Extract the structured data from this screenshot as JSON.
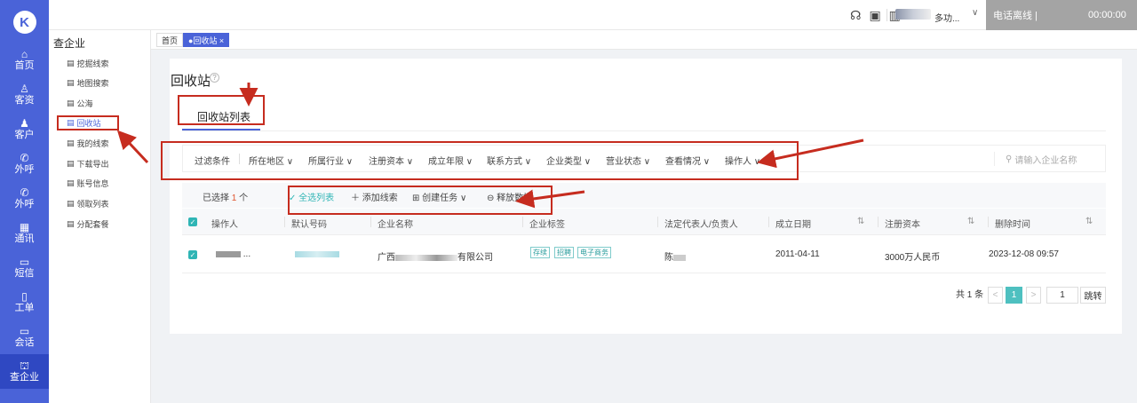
{
  "rail": {
    "logo": "K",
    "items": [
      {
        "label": "首页",
        "icon": "home-icon",
        "glyph": "⌂"
      },
      {
        "label": "客资",
        "icon": "users-icon",
        "glyph": "♙"
      },
      {
        "label": "客户",
        "icon": "customer-icon",
        "glyph": "♟"
      },
      {
        "label": "外呼",
        "icon": "phone-icon",
        "glyph": "✆"
      },
      {
        "label": "外呼",
        "icon": "phone-out-icon",
        "glyph": "✆"
      },
      {
        "label": "通讯",
        "icon": "contacts-icon",
        "glyph": "▦"
      },
      {
        "label": "短信",
        "icon": "sms-icon",
        "glyph": "▭"
      },
      {
        "label": "工单",
        "icon": "ticket-icon",
        "glyph": "▯"
      },
      {
        "label": "会话",
        "icon": "chat-icon",
        "glyph": "▭"
      },
      {
        "label": "查企业",
        "icon": "building-icon",
        "glyph": "⛫"
      }
    ]
  },
  "topbar": {
    "user_name": "多功...",
    "phone_status": "电话离线 |",
    "timer": "00:00:00"
  },
  "sub_sidebar": {
    "title": "查企业",
    "items": [
      "挖掘线索",
      "地图搜索",
      "公海",
      "回收站",
      "我的线索",
      "下载导出",
      "账号信息",
      "领取列表",
      "分配套餐"
    ]
  },
  "tabs": {
    "home": "首页",
    "active": "●回收站 ×"
  },
  "page": {
    "title": "回收站",
    "help": "?",
    "subtab": "回收站列表"
  },
  "filters": {
    "label": "过滤条件",
    "items": [
      "所在地区 ∨",
      "所属行业 ∨",
      "注册资本 ∨",
      "成立年限 ∨",
      "联系方式 ∨",
      "企业类型 ∨",
      "营业状态 ∨",
      "查看情况 ∨",
      "操作人 ∨"
    ],
    "search_placeholder": "请输入企业名称"
  },
  "actions": {
    "selected_prefix": "已选择",
    "selected_count": "1",
    "selected_suffix": "个",
    "select_all": "全选列表",
    "add_lead": "添加线索",
    "create_task": "创建任务 ∨",
    "release": "释放数据"
  },
  "table": {
    "headers": [
      "操作人",
      "默认号码",
      "企业名称",
      "企业标签",
      "法定代表人/负责人",
      "成立日期",
      "注册资本",
      "删除时间"
    ],
    "row": {
      "operator": "...",
      "company_prefix": "广西",
      "company_suffix": "有限公司",
      "tags": [
        "存续",
        "招聘",
        "电子商务"
      ],
      "legal_rep": "陈",
      "founded": "2011-04-11",
      "capital": "3000万人民币",
      "deleted_at": "2023-12-08 09:57"
    }
  },
  "pager": {
    "total": "共 1 条",
    "prev": "<",
    "current": "1",
    "next": ">",
    "jump_value": "1",
    "jump_label": "跳转"
  },
  "colors": {
    "rail": "#4a63d8",
    "accent_teal": "#4ec0c0",
    "annotation_red": "#c62c1f"
  }
}
